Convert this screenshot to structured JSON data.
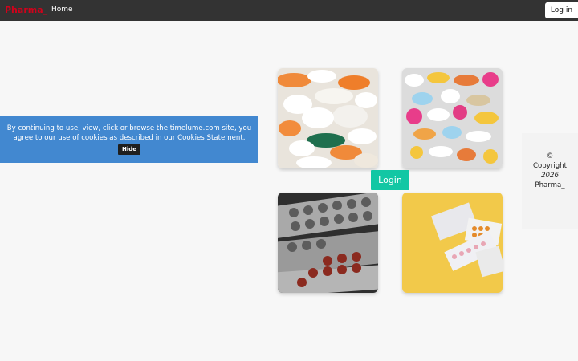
{
  "navbar": {
    "brand": "Pharma_",
    "home_label": "Home",
    "login_label": "Log in"
  },
  "cookie_banner": {
    "message": "By continuing to use, view, click or browse the timelume.com site, you agree to our use of cookies as described in our Cookies Statement.",
    "hide_label": "Hide"
  },
  "main": {
    "login_button": "Login",
    "gallery": [
      {
        "alt": "white and orange capsules"
      },
      {
        "alt": "colorful pills and capsules"
      },
      {
        "alt": "blister packs of tablets"
      },
      {
        "alt": "pill blister packs on yellow background"
      }
    ]
  },
  "footer": {
    "copyright_symbol": "©",
    "copyright_word": "Copyright",
    "year": "2026",
    "company": "Pharma_"
  },
  "colors": {
    "navbar_bg": "#333333",
    "brand_red": "#d0021b",
    "cookie_blue": "#4288d0",
    "login_teal": "#12c7a4",
    "page_bg": "#f7f7f7"
  }
}
